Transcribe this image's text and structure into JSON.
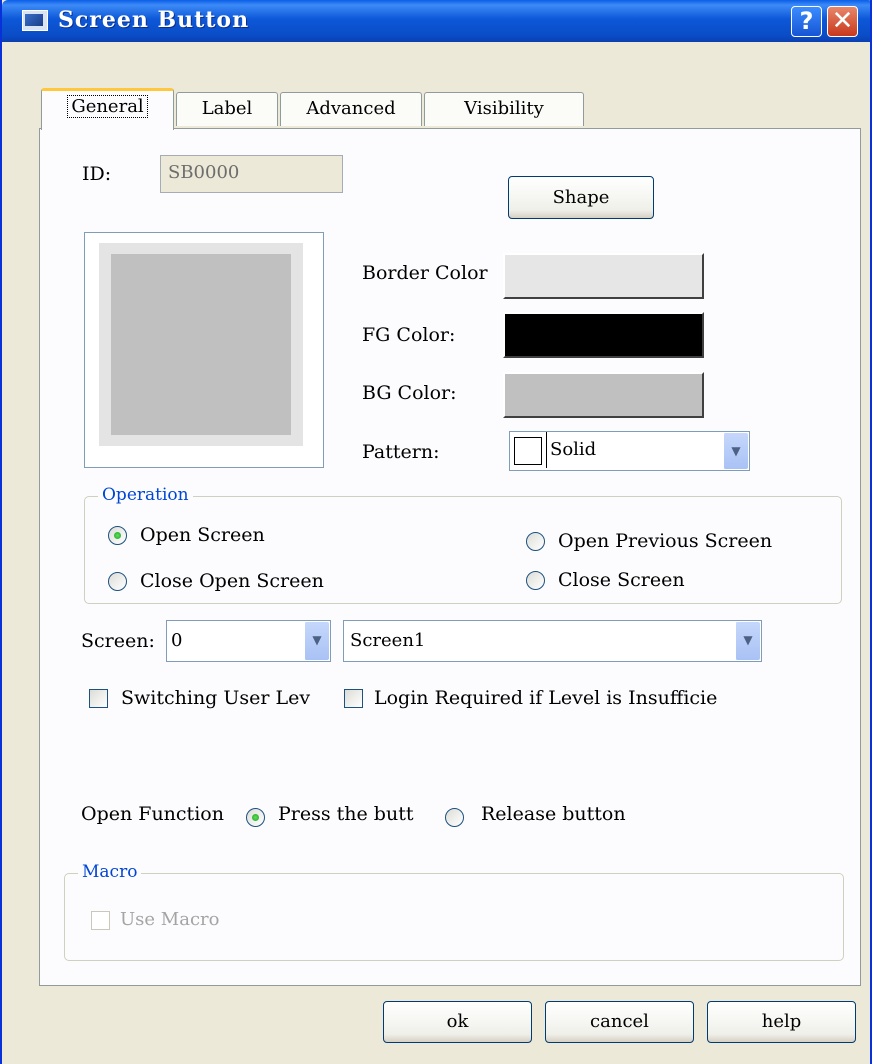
{
  "window": {
    "title": "Screen Button",
    "help_glyph": "?",
    "close_glyph": "✕"
  },
  "tabs": [
    {
      "label": "General",
      "active": true
    },
    {
      "label": "Label",
      "active": false
    },
    {
      "label": "Advanced",
      "active": false
    },
    {
      "label": "Visibility",
      "active": false
    }
  ],
  "general": {
    "id_label": "ID:",
    "id_value": "SB0000",
    "shape_button": "Shape",
    "border_color_label": "Border Color",
    "fg_color_label": "FG Color:",
    "bg_color_label": "BG Color:",
    "pattern_label": "Pattern:",
    "pattern_value": "Solid",
    "colors": {
      "border": "#e6e6e6",
      "fg": "#000000",
      "bg": "#c0c0c0",
      "preview_outer": "#e4e4e4",
      "preview_inner": "#c0c0c0"
    }
  },
  "operation": {
    "title": "Operation",
    "options": [
      {
        "label": "Open Screen",
        "selected": true
      },
      {
        "label": "Open Previous Screen",
        "selected": false
      },
      {
        "label": "Close Open Screen",
        "selected": false
      },
      {
        "label": "Close Screen",
        "selected": false
      }
    ]
  },
  "screen": {
    "label": "Screen:",
    "number_value": "0",
    "name_value": "Screen1"
  },
  "checkboxes": {
    "switching_user_level": "Switching User Lev",
    "login_required": "Login Required  if  Level is Insufficie"
  },
  "open_function": {
    "label": "Open Function",
    "press_label": "Press the butt",
    "press_selected": true,
    "release_label": "Release button"
  },
  "macro": {
    "title": "Macro",
    "use_macro_label": "Use Macro"
  },
  "footer": {
    "ok": "ok",
    "cancel": "cancel",
    "help": "help"
  }
}
